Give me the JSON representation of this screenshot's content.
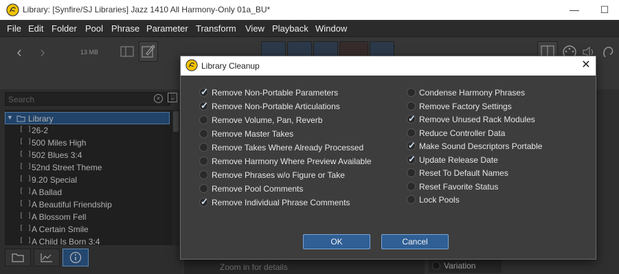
{
  "window": {
    "title": "Library: [Synfire/SJ Libraries] Jazz 1410 All Harmony-Only 01a_BU*",
    "controls": {
      "minimize": "—",
      "maximize": "☐"
    }
  },
  "menu": [
    "File",
    "Edit",
    "Folder",
    "Pool",
    "Phrase",
    "Parameter",
    "Transform",
    "View",
    "Playback",
    "Window"
  ],
  "toolbar": {
    "size_label": "13 MB"
  },
  "left_panel": {
    "search_placeholder": "Search",
    "tree_root": "Library",
    "items": [
      "26-2",
      "500 Miles High",
      "502 Blues 3:4",
      "52nd Street Theme",
      "9.20 Special",
      "A Ballad",
      "A Beautiful Friendship",
      "A Blossom Fell",
      "A Certain Smile",
      "A Child Is Born 3:4"
    ]
  },
  "main": {
    "zoom_hint": "Zoom in for details",
    "variation_label": "Variation"
  },
  "dialog": {
    "title": "Library Cleanup",
    "left_options": [
      {
        "label": "Remove Non-Portable Parameters",
        "checked": true
      },
      {
        "label": "Remove Non-Portable Articulations",
        "checked": true
      },
      {
        "label": "Remove Volume, Pan, Reverb",
        "checked": false
      },
      {
        "label": "Remove Master Takes",
        "checked": false
      },
      {
        "label": "Remove Takes Where Already Processed",
        "checked": false
      },
      {
        "label": "Remove Harmony Where Preview Available",
        "checked": false
      },
      {
        "label": "Remove Phrases w/o Figure or Take",
        "checked": false
      },
      {
        "label": "Remove Pool Comments",
        "checked": false
      },
      {
        "label": "Remove Individual Phrase Comments",
        "checked": true
      }
    ],
    "right_options": [
      {
        "label": "Condense Harmony Phrases",
        "checked": false
      },
      {
        "label": "Remove Factory Settings",
        "checked": false
      },
      {
        "label": "Remove Unused Rack Modules",
        "checked": true
      },
      {
        "label": "Reduce Controller Data",
        "checked": false
      },
      {
        "label": "Make Sound Descriptors Portable",
        "checked": true
      },
      {
        "label": "Update Release Date",
        "checked": true
      },
      {
        "label": "Reset To Default Names",
        "checked": false
      },
      {
        "label": "Reset Favorite Status",
        "checked": false
      },
      {
        "label": "Lock Pools",
        "checked": false
      }
    ],
    "ok_label": "OK",
    "cancel_label": "Cancel",
    "check_glyph": "✓"
  },
  "colors": {
    "accent": "#2f5f95",
    "check": "#cfe3ff"
  }
}
